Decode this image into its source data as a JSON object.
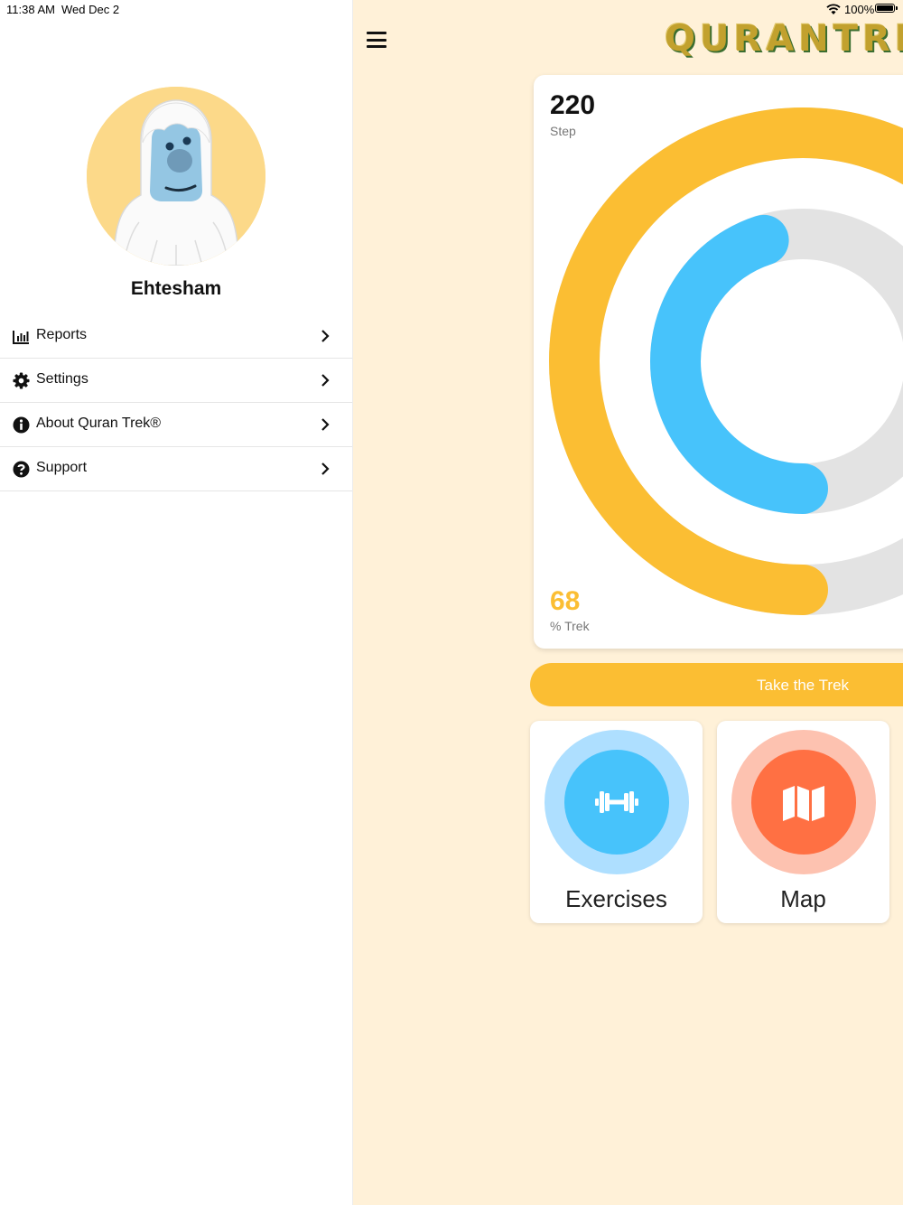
{
  "status_bar": {
    "time": "11:38 AM",
    "date": "Wed Dec 2",
    "battery_percent": "100%"
  },
  "sidebar": {
    "user_name": "Ehtesham",
    "avatar_icon": "yeti-avatar-icon",
    "items": [
      {
        "label": "Reports",
        "icon": "bar-chart-icon"
      },
      {
        "label": "Settings",
        "icon": "gear-icon"
      },
      {
        "label": "About Quran Trek®",
        "icon": "info-icon"
      },
      {
        "label": "Support",
        "icon": "question-icon"
      }
    ]
  },
  "header": {
    "logo_text": "QURANTREK"
  },
  "progress": {
    "step_value": "220",
    "step_label": "Step",
    "trek_value": "68",
    "trek_label": "% Trek",
    "outer_ring_fraction": 0.68,
    "inner_ring_fraction": 0.45,
    "colors": {
      "outer": "#fbbe33",
      "inner": "#47c3fb",
      "track": "#e3e3e3"
    }
  },
  "cta": {
    "label": "Take the Trek"
  },
  "tiles": {
    "exercises": {
      "label": "Exercises",
      "icon": "dumbbell-icon"
    },
    "map": {
      "label": "Map",
      "icon": "map-icon"
    }
  },
  "colors": {
    "main_bg": "#fff1d8",
    "accent": "#fbbe33",
    "exercise": "#47c3fb",
    "map": "#ff7043"
  }
}
